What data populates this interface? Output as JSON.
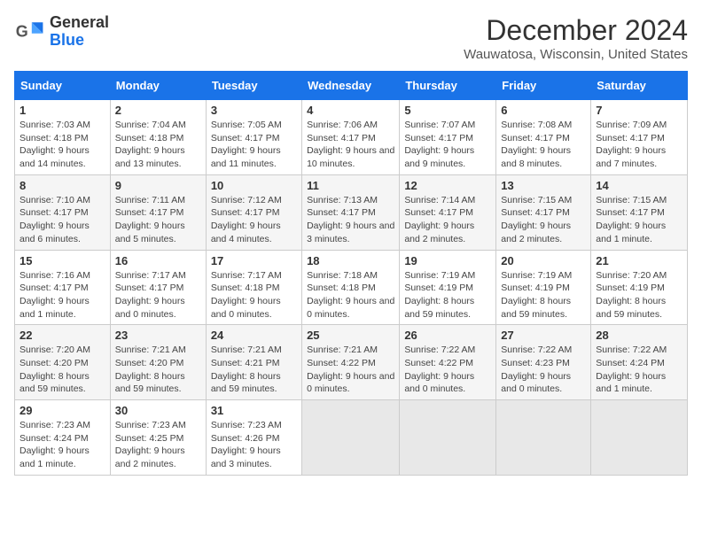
{
  "header": {
    "logo_general": "General",
    "logo_blue": "Blue",
    "month_title": "December 2024",
    "location": "Wauwatosa, Wisconsin, United States"
  },
  "columns": [
    "Sunday",
    "Monday",
    "Tuesday",
    "Wednesday",
    "Thursday",
    "Friday",
    "Saturday"
  ],
  "weeks": [
    [
      {
        "day": "1",
        "info": "Sunrise: 7:03 AM\nSunset: 4:18 PM\nDaylight: 9 hours and 14 minutes."
      },
      {
        "day": "2",
        "info": "Sunrise: 7:04 AM\nSunset: 4:18 PM\nDaylight: 9 hours and 13 minutes."
      },
      {
        "day": "3",
        "info": "Sunrise: 7:05 AM\nSunset: 4:17 PM\nDaylight: 9 hours and 11 minutes."
      },
      {
        "day": "4",
        "info": "Sunrise: 7:06 AM\nSunset: 4:17 PM\nDaylight: 9 hours and 10 minutes."
      },
      {
        "day": "5",
        "info": "Sunrise: 7:07 AM\nSunset: 4:17 PM\nDaylight: 9 hours and 9 minutes."
      },
      {
        "day": "6",
        "info": "Sunrise: 7:08 AM\nSunset: 4:17 PM\nDaylight: 9 hours and 8 minutes."
      },
      {
        "day": "7",
        "info": "Sunrise: 7:09 AM\nSunset: 4:17 PM\nDaylight: 9 hours and 7 minutes."
      }
    ],
    [
      {
        "day": "8",
        "info": "Sunrise: 7:10 AM\nSunset: 4:17 PM\nDaylight: 9 hours and 6 minutes."
      },
      {
        "day": "9",
        "info": "Sunrise: 7:11 AM\nSunset: 4:17 PM\nDaylight: 9 hours and 5 minutes."
      },
      {
        "day": "10",
        "info": "Sunrise: 7:12 AM\nSunset: 4:17 PM\nDaylight: 9 hours and 4 minutes."
      },
      {
        "day": "11",
        "info": "Sunrise: 7:13 AM\nSunset: 4:17 PM\nDaylight: 9 hours and 3 minutes."
      },
      {
        "day": "12",
        "info": "Sunrise: 7:14 AM\nSunset: 4:17 PM\nDaylight: 9 hours and 2 minutes."
      },
      {
        "day": "13",
        "info": "Sunrise: 7:15 AM\nSunset: 4:17 PM\nDaylight: 9 hours and 2 minutes."
      },
      {
        "day": "14",
        "info": "Sunrise: 7:15 AM\nSunset: 4:17 PM\nDaylight: 9 hours and 1 minute."
      }
    ],
    [
      {
        "day": "15",
        "info": "Sunrise: 7:16 AM\nSunset: 4:17 PM\nDaylight: 9 hours and 1 minute."
      },
      {
        "day": "16",
        "info": "Sunrise: 7:17 AM\nSunset: 4:17 PM\nDaylight: 9 hours and 0 minutes."
      },
      {
        "day": "17",
        "info": "Sunrise: 7:17 AM\nSunset: 4:18 PM\nDaylight: 9 hours and 0 minutes."
      },
      {
        "day": "18",
        "info": "Sunrise: 7:18 AM\nSunset: 4:18 PM\nDaylight: 9 hours and 0 minutes."
      },
      {
        "day": "19",
        "info": "Sunrise: 7:19 AM\nSunset: 4:19 PM\nDaylight: 8 hours and 59 minutes."
      },
      {
        "day": "20",
        "info": "Sunrise: 7:19 AM\nSunset: 4:19 PM\nDaylight: 8 hours and 59 minutes."
      },
      {
        "day": "21",
        "info": "Sunrise: 7:20 AM\nSunset: 4:19 PM\nDaylight: 8 hours and 59 minutes."
      }
    ],
    [
      {
        "day": "22",
        "info": "Sunrise: 7:20 AM\nSunset: 4:20 PM\nDaylight: 8 hours and 59 minutes."
      },
      {
        "day": "23",
        "info": "Sunrise: 7:21 AM\nSunset: 4:20 PM\nDaylight: 8 hours and 59 minutes."
      },
      {
        "day": "24",
        "info": "Sunrise: 7:21 AM\nSunset: 4:21 PM\nDaylight: 8 hours and 59 minutes."
      },
      {
        "day": "25",
        "info": "Sunrise: 7:21 AM\nSunset: 4:22 PM\nDaylight: 9 hours and 0 minutes."
      },
      {
        "day": "26",
        "info": "Sunrise: 7:22 AM\nSunset: 4:22 PM\nDaylight: 9 hours and 0 minutes."
      },
      {
        "day": "27",
        "info": "Sunrise: 7:22 AM\nSunset: 4:23 PM\nDaylight: 9 hours and 0 minutes."
      },
      {
        "day": "28",
        "info": "Sunrise: 7:22 AM\nSunset: 4:24 PM\nDaylight: 9 hours and 1 minute."
      }
    ],
    [
      {
        "day": "29",
        "info": "Sunrise: 7:23 AM\nSunset: 4:24 PM\nDaylight: 9 hours and 1 minute."
      },
      {
        "day": "30",
        "info": "Sunrise: 7:23 AM\nSunset: 4:25 PM\nDaylight: 9 hours and 2 minutes."
      },
      {
        "day": "31",
        "info": "Sunrise: 7:23 AM\nSunset: 4:26 PM\nDaylight: 9 hours and 3 minutes."
      },
      {
        "day": "",
        "info": ""
      },
      {
        "day": "",
        "info": ""
      },
      {
        "day": "",
        "info": ""
      },
      {
        "day": "",
        "info": ""
      }
    ]
  ]
}
